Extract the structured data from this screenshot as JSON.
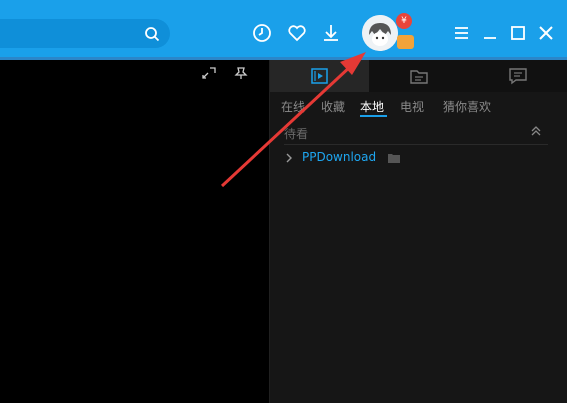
{
  "search": {
    "value": ""
  },
  "toolbar": {
    "icons": [
      "clock-icon",
      "heart-icon",
      "download-icon",
      "menu-icon",
      "minimize-icon",
      "maximize-icon",
      "close-icon"
    ]
  },
  "account": {
    "vip_badge": "¥"
  },
  "sidebar": {
    "tabs": [
      "play-list-icon",
      "folder-icon",
      "message-icon"
    ],
    "subtabs": [
      "在线",
      "收藏",
      "本地",
      "电视",
      "猜你喜欢"
    ],
    "active_subtab": "本地",
    "section_title": "待看",
    "items": [
      {
        "label": "PPDownload"
      }
    ]
  },
  "colors": {
    "titlebar": "#1aa0ea",
    "accent": "#1aa0ea",
    "panel": "#161616",
    "link": "#1ea6f0",
    "annotation_arrow": "#e53935"
  }
}
